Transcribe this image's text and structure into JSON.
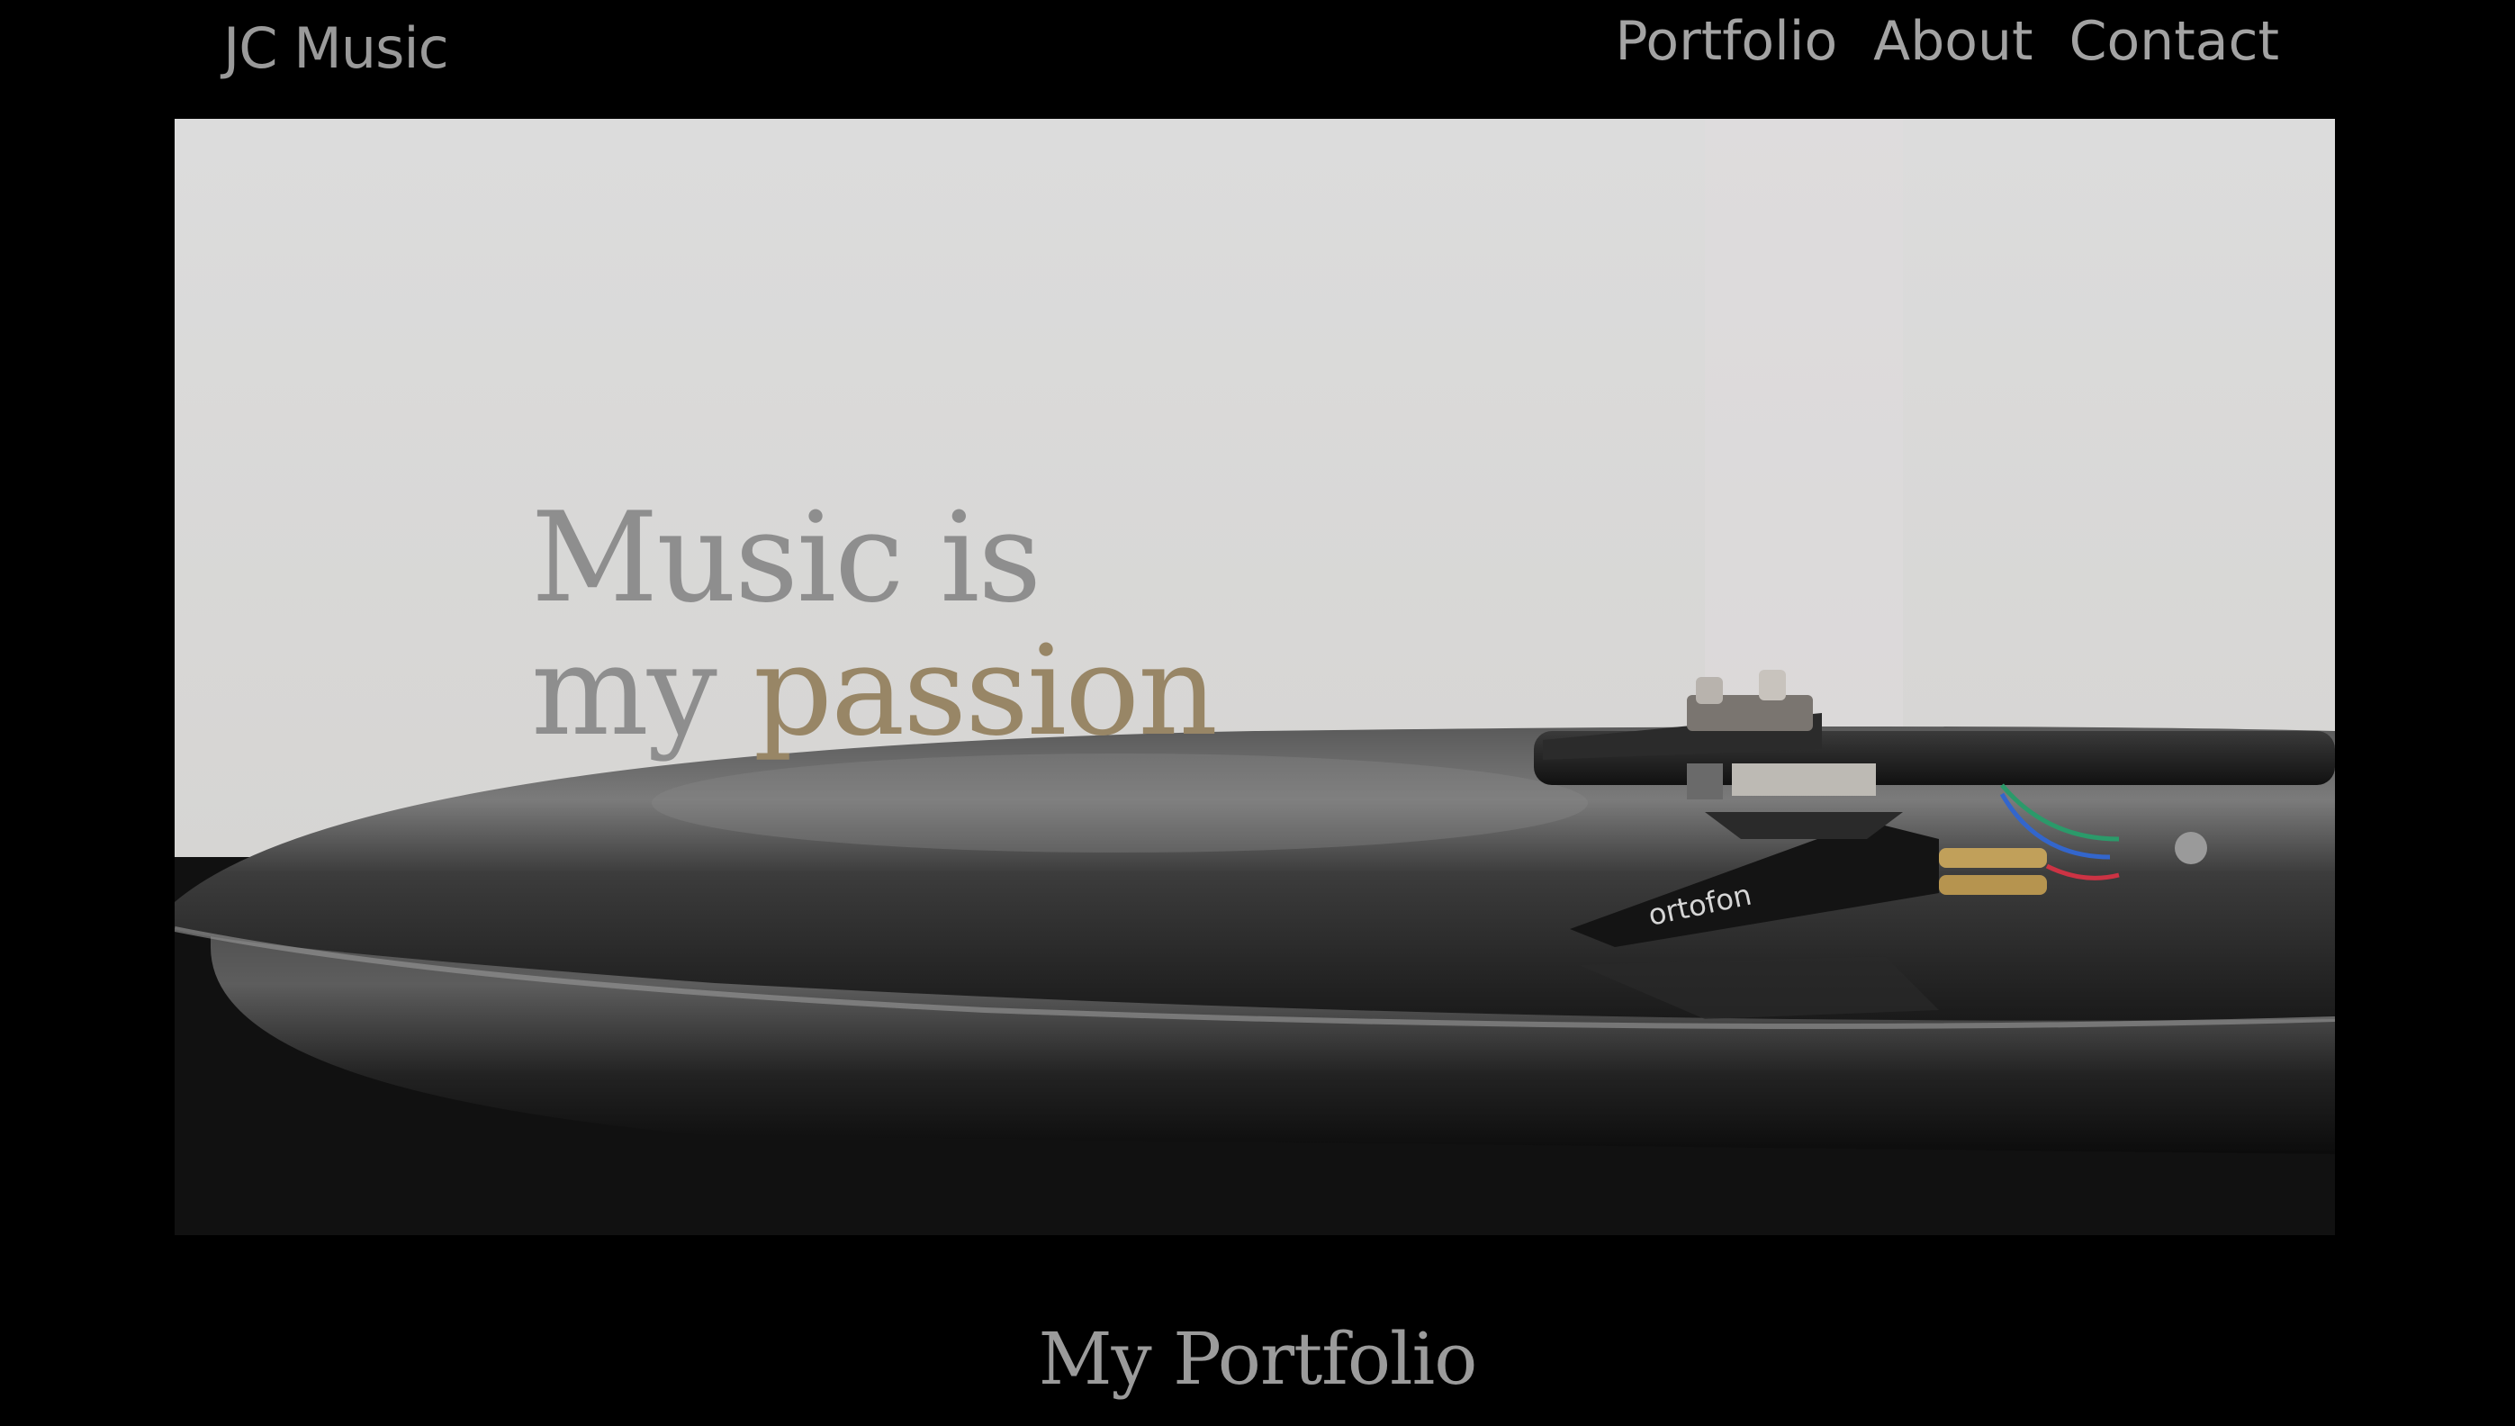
{
  "header": {
    "brand": "JC Music",
    "nav": [
      "Portfolio",
      "About",
      "Contact"
    ]
  },
  "hero": {
    "headline_line1": "Music is",
    "headline_line2_plain": "my",
    "headline_line2_accent": "passion",
    "image_label": "ortofon"
  },
  "portfolio": {
    "title": "My Portfolio"
  },
  "colors": {
    "background": "#000000",
    "nav_text": "#a3a3a3",
    "headline_gray": "#8e8e8e",
    "headline_accent": "#988666"
  }
}
